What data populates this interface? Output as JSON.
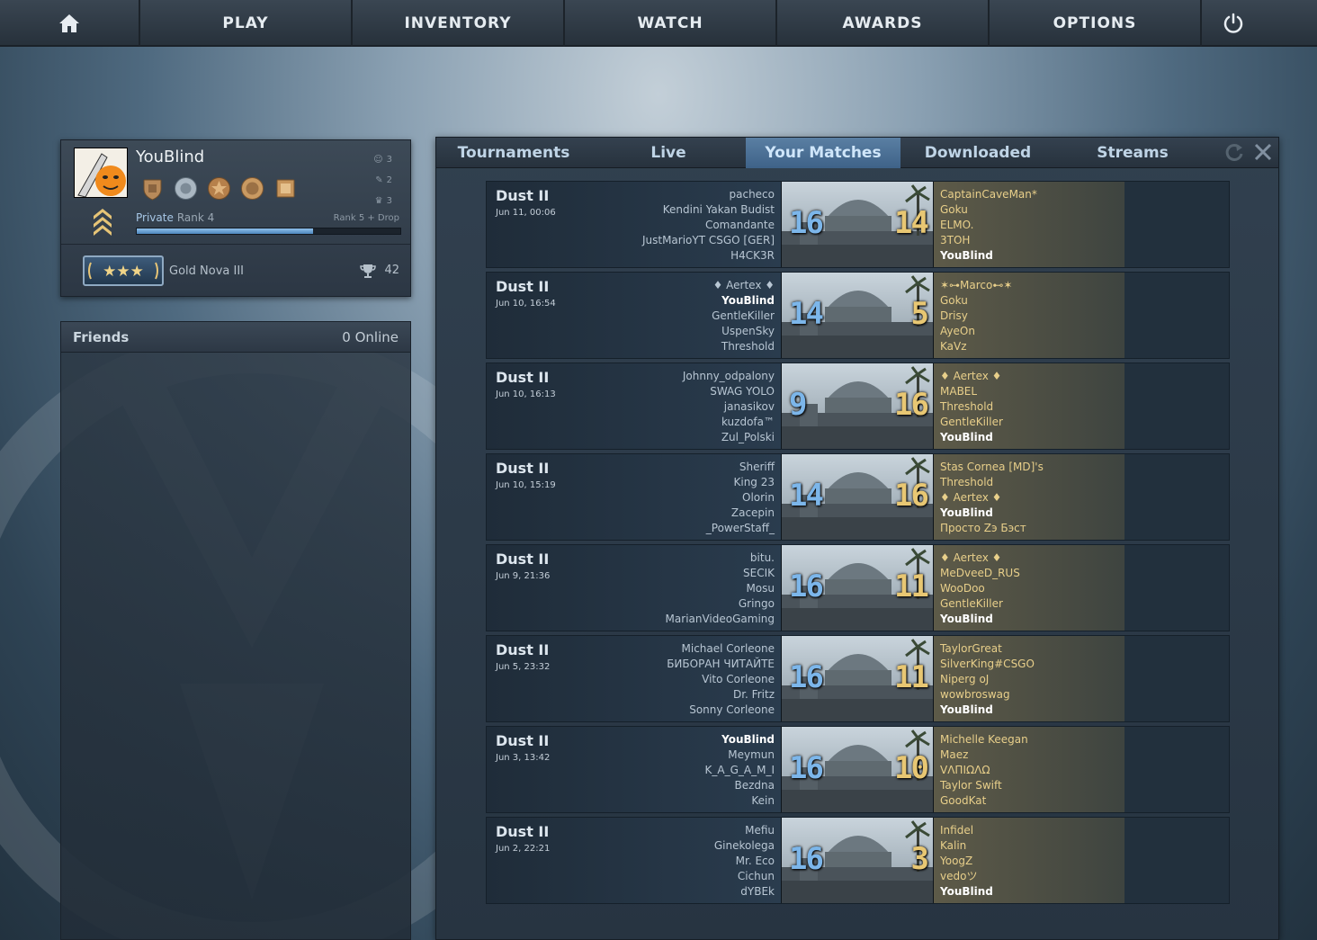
{
  "nav": {
    "items": [
      "PLAY",
      "INVENTORY",
      "WATCH",
      "AWARDS",
      "OPTIONS"
    ]
  },
  "profile": {
    "username": "YouBlind",
    "stats": [
      "3",
      "2",
      "3"
    ],
    "rank_name": "Private",
    "rank_level": "Rank 4",
    "rank_next": "Rank 5 + Drop",
    "xp_fraction": 0.67,
    "skill_group": "Gold Nova III",
    "wins": "42"
  },
  "friends": {
    "title": "Friends",
    "online": "0 Online"
  },
  "tabs": [
    "Tournaments",
    "Live",
    "Your Matches",
    "Downloaded",
    "Streams"
  ],
  "active_tab": 2,
  "colors": {
    "ct_score": "#7cb6ea",
    "t_score": "#e8c773",
    "active_tab": "#4b6f94"
  },
  "matches": [
    {
      "map": "Dust II",
      "date": "Jun 11, 00:06",
      "score_ct": "16",
      "score_t": "14",
      "ct": [
        "pacheco",
        "Kendini Yakan Budist",
        "Comandante",
        "JustMarioYT CSGO [GER]",
        "H4CK3R"
      ],
      "t": [
        "CaptainCaveMan*",
        "Goku",
        "ELMO.",
        "3TOH",
        "YouBlind"
      ]
    },
    {
      "map": "Dust II",
      "date": "Jun 10, 16:54",
      "score_ct": "14",
      "score_t": "5",
      "ct": [
        "♦ Aertex ♦",
        "YouBlind",
        "GentleKiller",
        "UspenSky",
        "Threshold"
      ],
      "t": [
        "✶⊶Marco⊷✶",
        "Goku",
        "Drisy",
        "AyeOn",
        "KaVz"
      ]
    },
    {
      "map": "Dust II",
      "date": "Jun 10, 16:13",
      "score_ct": "9",
      "score_t": "16",
      "ct": [
        "Johnny_odpalony",
        "SWAG YOLO",
        "janasikov",
        "kuzdofa™",
        "Zul_Polski"
      ],
      "t": [
        "♦ Aertex ♦",
        "MABEL",
        "Threshold",
        "GentleKiller",
        "YouBlind"
      ]
    },
    {
      "map": "Dust II",
      "date": "Jun 10, 15:19",
      "score_ct": "14",
      "score_t": "16",
      "ct": [
        "Sheriff",
        "King 23",
        "Olorin",
        "Zacepin",
        "_PowerStaff_"
      ],
      "t": [
        "Stas Cornea [MD]'s",
        "Threshold",
        "♦ Aertex ♦",
        "YouBlind",
        "Просто Zэ Бэст"
      ]
    },
    {
      "map": "Dust II",
      "date": "Jun 9, 21:36",
      "score_ct": "16",
      "score_t": "11",
      "ct": [
        "bitu.",
        "SECIK",
        "Mosu",
        "Gringo",
        "MarianVideoGaming"
      ],
      "t": [
        "♦ Aertex ♦",
        "MeDveeD_RUS",
        "WooDoo",
        "GentleKiller",
        "YouBlind"
      ]
    },
    {
      "map": "Dust II",
      "date": "Jun 5, 23:32",
      "score_ct": "16",
      "score_t": "11",
      "ct": [
        "Michael Corleone",
        "БИБОРАН ЧИТАЙТЕ",
        "Vito Corleone",
        "Dr. Fritz",
        "Sonny Corleone"
      ],
      "t": [
        "TaylorGreat",
        "SilverKing#CSGO",
        "Niperg oJ",
        "wowbroswag",
        "YouBlind"
      ]
    },
    {
      "map": "Dust II",
      "date": "Jun 3, 13:42",
      "score_ct": "16",
      "score_t": "10",
      "ct": [
        "YouBlind",
        "Meymun",
        "K_A_G_A_M_I",
        "Bezdna",
        "Kein"
      ],
      "t": [
        "Michelle Keegan",
        "Maez",
        "VΛΠIΩΛΩ",
        "Taylor Swift",
        "GoodKat"
      ]
    },
    {
      "map": "Dust II",
      "date": "Jun 2, 22:21",
      "score_ct": "16",
      "score_t": "3",
      "ct": [
        "Mefiu",
        "Ginekolega",
        "Mr. Eco",
        "Cichun",
        "dYBEk"
      ],
      "t": [
        "Infidel",
        "Kalin",
        "YoogZ",
        "vedoツ",
        "YouBlind"
      ]
    }
  ]
}
